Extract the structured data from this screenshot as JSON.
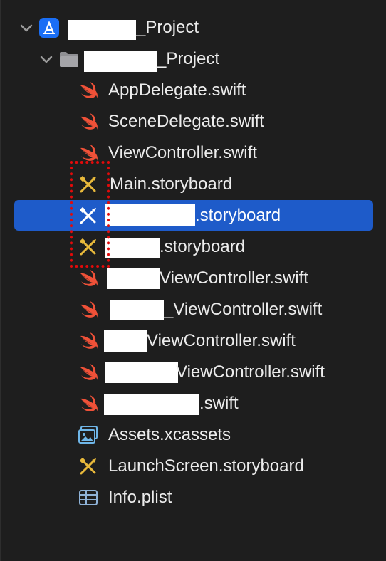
{
  "navigator": {
    "root_project": {
      "label": "_Project",
      "icon": "xcode-project-icon"
    },
    "root_group": {
      "label": "_Project",
      "icon": "folder-icon"
    },
    "files": [
      {
        "label": "AppDelegate.swift",
        "icon": "swift-icon"
      },
      {
        "label": "SceneDelegate.swift",
        "icon": "swift-icon"
      },
      {
        "label": "ViewController.swift",
        "icon": "swift-icon"
      },
      {
        "label": "Main.storyboard",
        "icon": "storyboard-icon"
      },
      {
        "label": ".storyboard",
        "icon": "storyboard-icon",
        "selected": true
      },
      {
        "label": ".storyboard",
        "icon": "storyboard-icon"
      },
      {
        "label": "ViewController.swift",
        "icon": "swift-icon"
      },
      {
        "label": "_ViewController.swift",
        "icon": "swift-icon"
      },
      {
        "label": "ViewController.swift",
        "icon": "swift-icon"
      },
      {
        "label": "ViewController.swift",
        "icon": "swift-icon"
      },
      {
        "label": ".swift",
        "icon": "swift-icon"
      },
      {
        "label": "Assets.xcassets",
        "icon": "asset-catalog-icon"
      },
      {
        "label": "LaunchScreen.storyboard",
        "icon": "storyboard-icon"
      },
      {
        "label": "Info.plist",
        "icon": "plist-table-icon"
      }
    ]
  },
  "colors": {
    "background": "#1e1e1e",
    "selection": "#1e5bc9",
    "swift": "#f05138",
    "storyboard": "#e8b93b",
    "annotation": "#e30a0a"
  }
}
